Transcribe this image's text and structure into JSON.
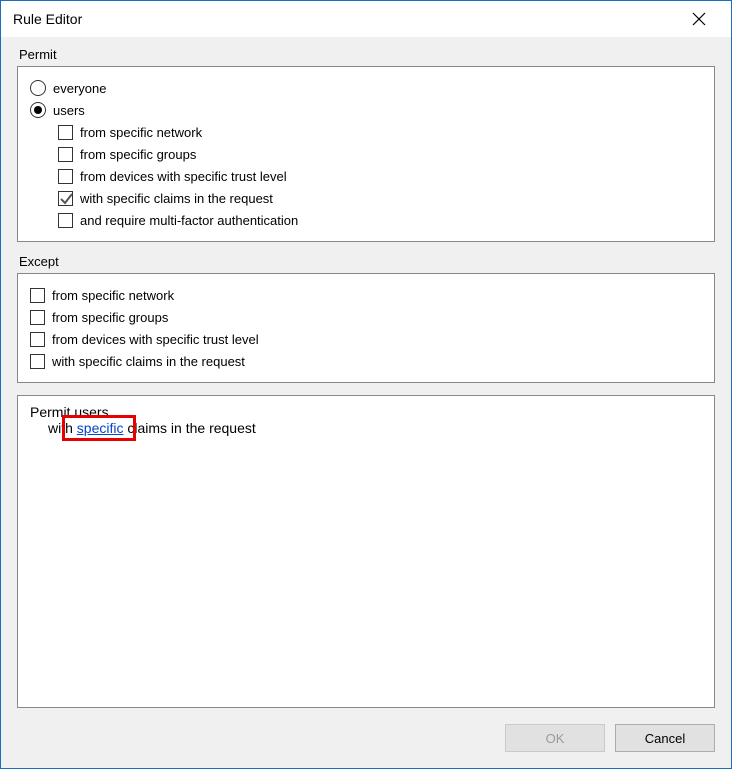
{
  "window": {
    "title": "Rule Editor"
  },
  "permit": {
    "label": "Permit",
    "radios": {
      "everyone": {
        "label": "everyone",
        "checked": false
      },
      "users": {
        "label": "users",
        "checked": true
      }
    },
    "userChecks": [
      {
        "label": "from specific network",
        "checked": false
      },
      {
        "label": "from specific groups",
        "checked": false
      },
      {
        "label": "from devices with specific trust level",
        "checked": false
      },
      {
        "label": "with specific claims in the request",
        "checked": true
      },
      {
        "label": "and require multi-factor authentication",
        "checked": false
      }
    ]
  },
  "except": {
    "label": "Except",
    "checks": [
      {
        "label": "from specific network",
        "checked": false
      },
      {
        "label": "from specific groups",
        "checked": false
      },
      {
        "label": "from devices with specific trust level",
        "checked": false
      },
      {
        "label": "with specific claims in the request",
        "checked": false
      }
    ]
  },
  "summary": {
    "line1": "Permit users",
    "line2_pre": "with ",
    "line2_link": "specific",
    "line2_post": " claims in the request"
  },
  "buttons": {
    "ok": "OK",
    "cancel": "Cancel"
  }
}
